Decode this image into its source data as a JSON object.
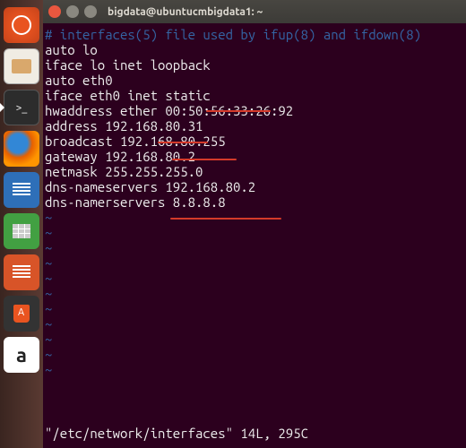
{
  "window": {
    "title": "bigdata@ubuntucmbigdata1: ~"
  },
  "terminal": {
    "comment_line": "# interfaces(5) file used by ifup(8) and ifdown(8)",
    "lines": [
      "auto lo",
      "iface lo inet loopback",
      "",
      "auto eth0",
      "iface eth0 inet static",
      "hwaddress ether 00:50:56:33:26:92",
      "address 192.168.80.31",
      "broadcast 192.168.80.255",
      "gateway 192.168.80.2",
      "netmask 255.255.255.0",
      "",
      "dns-nameservers 192.168.80.2",
      "dns-namerservers 8.8.8.8"
    ],
    "tilde": "~",
    "status": "\"/etc/network/interfaces\" 14L, 295C"
  },
  "launcher": {
    "dash": "dash",
    "files": "files",
    "terminal": "terminal",
    "firefox": "firefox",
    "docs": "docs",
    "calc": "calc",
    "impress": "impress",
    "software": "software",
    "amazon": "a"
  }
}
